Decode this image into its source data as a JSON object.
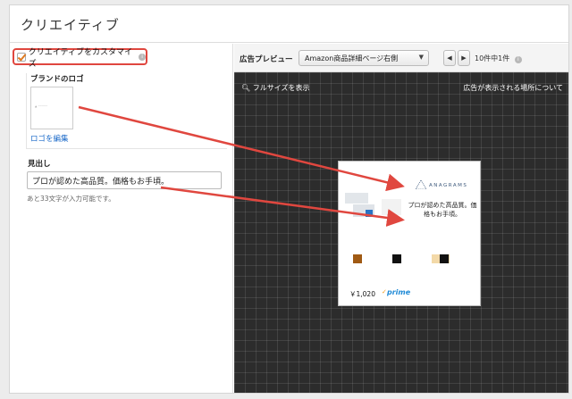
{
  "page": {
    "title": "クリエイティブ"
  },
  "left_panel": {
    "customize_label": "クリエイティブをカスタマイズ",
    "customize_checked": true,
    "brand_logo_label": "ブランドのロゴ",
    "edit_logo_link": "ロゴを編集",
    "headline_label": "見出し",
    "headline_value": "プロが認めた高品質。価格もお手頃。",
    "char_count": "あと33文字が入力可能です。"
  },
  "preview": {
    "label": "広告プレビュー",
    "placement_select": "Amazon商品詳細ページ右側",
    "prev_icon": "chevron-left-icon",
    "next_icon": "chevron-right-icon",
    "count": "10件中1件",
    "fullsize_link": "フルサイズを表示",
    "about_link": "広告が表示される場所について"
  },
  "ad": {
    "brand_name": "ANAGRAMS",
    "headline": "プロが認めた高品質。価格もお手頃。",
    "price": "￥1,020",
    "prime_label": "prime"
  },
  "colors": {
    "highlight": "#e0473f",
    "link": "#1b6ac9",
    "prime": "#1f8ad6",
    "canvas": "#2c2c2c"
  }
}
